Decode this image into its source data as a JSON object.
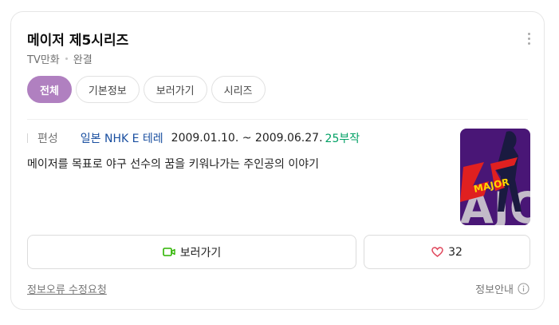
{
  "title": "메이저 제5시리즈",
  "subtitle": {
    "category": "TV만화",
    "status": "완결"
  },
  "tabs": [
    {
      "label": "전체",
      "active": true
    },
    {
      "label": "기본정보",
      "active": false
    },
    {
      "label": "보러가기",
      "active": false
    },
    {
      "label": "시리즈",
      "active": false
    }
  ],
  "info": {
    "label": "편성",
    "channel": "일본 NHK E 테레",
    "dates": "2009.01.10. ~ 2009.06.27.",
    "episodes": "25부작"
  },
  "description": "메이저를 목표로 야구 선수의 꿈을 키워나가는 주인공의 이야기",
  "poster": {
    "logo_text": "MAJOR",
    "accent": "#e02020",
    "background": "#5a1a8a"
  },
  "buttons": {
    "watch_label": "보러가기",
    "like_count": "32"
  },
  "footer": {
    "report_label": "정보오류 수정요청",
    "info_label": "정보안내"
  },
  "colors": {
    "tab_active": "#b080c0",
    "episodes": "#00a064",
    "channel": "#1a4fa0",
    "watch_icon": "#2db400",
    "heart": "#e0455a"
  }
}
